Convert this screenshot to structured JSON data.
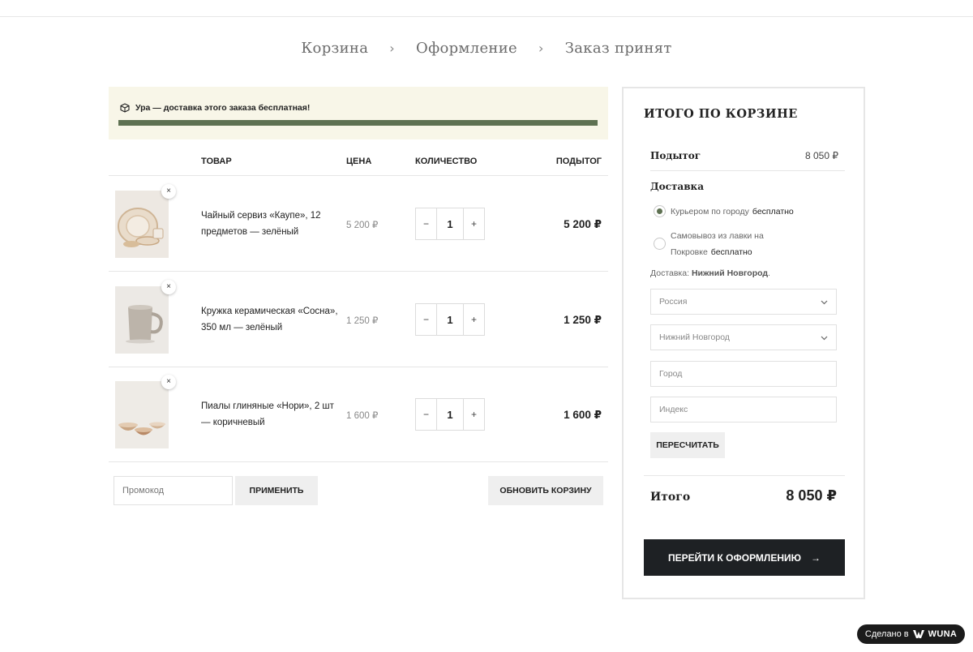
{
  "breadcrumb": {
    "step1": "Корзина",
    "step2": "Оформление",
    "step3": "Заказ принят",
    "separator": "›"
  },
  "notice": {
    "text": "Ура — доставка этого заказа бесплатная!",
    "progress": 1.0,
    "icon": "box-icon"
  },
  "table": {
    "headers": {
      "product": "Товар",
      "price": "Цена",
      "quantity": "Количество",
      "subtotal": "Подытог"
    },
    "rows": [
      {
        "name": "Чайный сервиз «Каупе», 12 предметов — зелёный",
        "price": "5 200 ₽",
        "qty": "1",
        "subtotal": "5 200 ₽"
      },
      {
        "name": "Кружка керамическая «Сосна», 350 мл — зелёный",
        "price": "1 250 ₽",
        "qty": "1",
        "subtotal": "1 250 ₽"
      },
      {
        "name": "Пиалы глиняные «Нори», 2 шт — коричневый",
        "price": "1 600 ₽",
        "qty": "1",
        "subtotal": "1 600 ₽"
      }
    ],
    "remove_symbol": "×",
    "minus": "−",
    "plus": "+"
  },
  "coupon": {
    "placeholder": "Промокод",
    "apply": "ПРИМЕНИТЬ"
  },
  "update_cart": "ОБНОВИТЬ КОРЗИНУ",
  "summary": {
    "title": "Итого по корзине",
    "subtotal_label": "Подытог",
    "subtotal_value": "8 050 ₽",
    "shipping_title": "Доставка",
    "option1_label": "Курьером по городу",
    "option1_price": "бесплатно",
    "option2_label_line1": "Самовывоз из лавки на",
    "option2_label_line2": "Покровке",
    "option2_price": "бесплатно",
    "destination_prefix": "Доставка:",
    "destination_value": "Нижний Новгород",
    "destination_suffix": ".",
    "country": "Россия",
    "region": "Нижний Новгород",
    "city_placeholder": "Город",
    "zip_placeholder": "Индекс",
    "recalc": "ПЕРЕСЧИТАТЬ",
    "total_label": "Итого",
    "total_value": "8 050 ₽",
    "checkout": "Перейти к оформлению",
    "arrow": "→"
  },
  "badge": {
    "prefix": "Сделано в",
    "brand": "WUNA"
  },
  "colors": {
    "accent": "#5e7152",
    "notice_bg": "#f8f6e8",
    "dark_button": "#1e2124"
  }
}
